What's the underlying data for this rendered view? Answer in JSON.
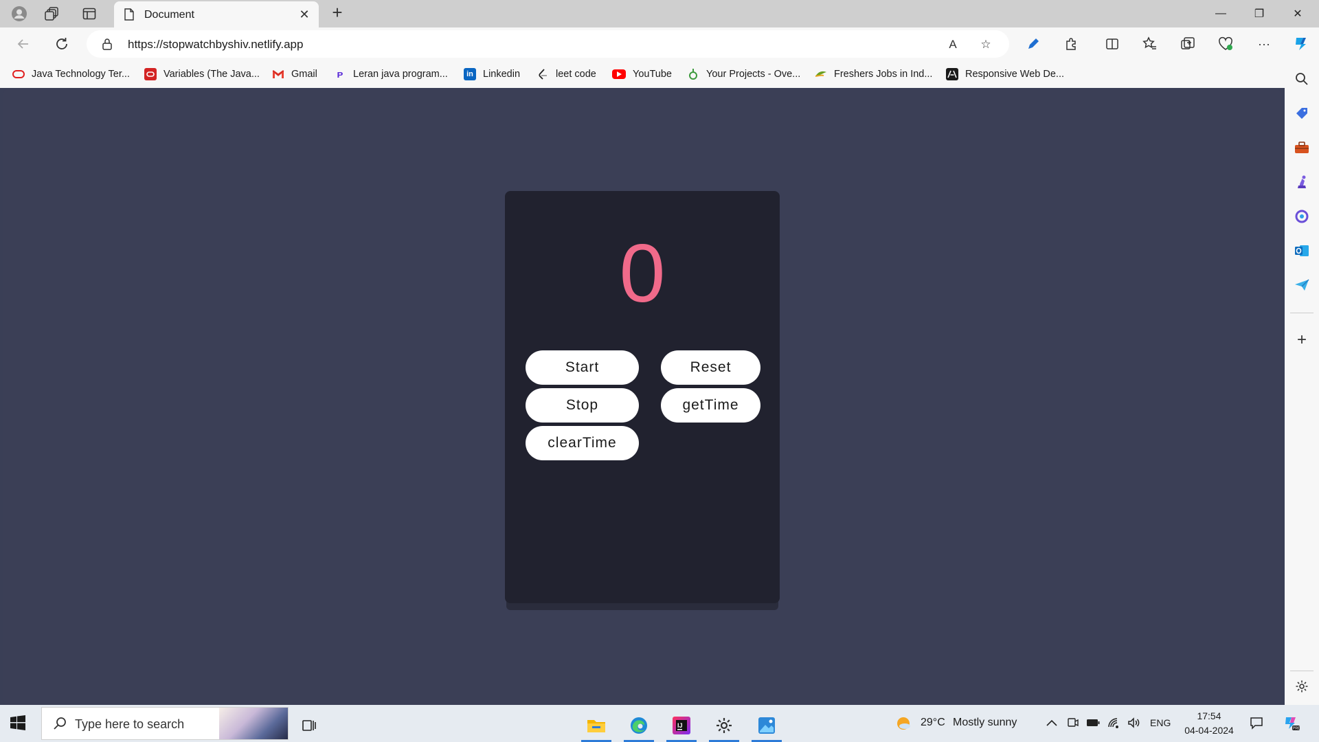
{
  "browser": {
    "tab": {
      "title": "Document",
      "close_glyph": "✕"
    },
    "new_tab_glyph": "+",
    "window_controls": {
      "minimize": "—",
      "maximize": "❐",
      "close": "✕"
    },
    "address": {
      "url": "https://stopwatchbyshiv.netlify.app"
    },
    "url_actions": {
      "read_aloud": "A",
      "favorite": "☆"
    },
    "toolbar": {
      "more": "···"
    }
  },
  "bookmarks": [
    {
      "label": "Java Technology Ter...",
      "icon": "oracle-icon",
      "color": "#e02020"
    },
    {
      "label": "Variables (The Java...",
      "icon": "oracle-square-icon",
      "color": "#d32424"
    },
    {
      "label": "Gmail",
      "icon": "gmail-icon",
      "color": "#ea4335"
    },
    {
      "label": "Leran java program...",
      "icon": "p-icon",
      "color": "#5a2bd8"
    },
    {
      "label": "Linkedin",
      "icon": "linkedin-icon",
      "color": "#0a66c2"
    },
    {
      "label": "leet code",
      "icon": "leetcode-icon",
      "color": "#222222"
    },
    {
      "label": "YouTube",
      "icon": "youtube-icon",
      "color": "#ff0000"
    },
    {
      "label": "Your Projects - Ove...",
      "icon": "project-icon",
      "color": "#3d9a3d"
    },
    {
      "label": "Freshers Jobs in Ind...",
      "icon": "freshers-icon",
      "color": "#6aa022"
    },
    {
      "label": "Responsive Web De...",
      "icon": "webdev-icon",
      "color": "#1b1b1b"
    }
  ],
  "stopwatch": {
    "display": "0",
    "buttons": {
      "start": "Start",
      "reset": "Reset",
      "stop": "Stop",
      "gettime": "getTime",
      "cleartime": "clearTime"
    },
    "display_color": "#f06a8a"
  },
  "sidebar": {
    "icons": [
      "search-icon",
      "tag-icon",
      "toolbox-icon",
      "chess-icon",
      "copilot-icon",
      "outlook-icon",
      "send-icon"
    ],
    "add_glyph": "+"
  },
  "taskbar": {
    "search_placeholder": "Type here to search",
    "weather": {
      "temp": "29°C",
      "condition": "Mostly sunny"
    },
    "language": "ENG",
    "time": "17:54",
    "date": "04-04-2024",
    "apps": [
      "file-explorer-icon",
      "edge-icon",
      "intellij-icon",
      "settings-icon",
      "photos-icon"
    ]
  },
  "colors": {
    "page_bg": "#3b3f56",
    "card_bg": "#21222f",
    "accent": "#f06a8a"
  }
}
